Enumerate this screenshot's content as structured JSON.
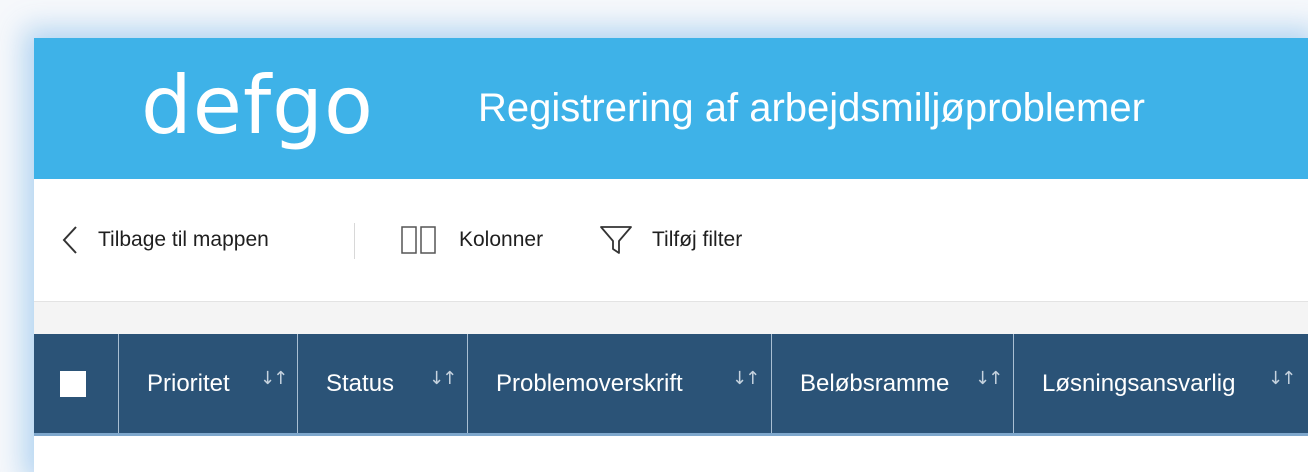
{
  "header": {
    "logo": "defgo",
    "title": "Registrering af arbejdsmiljøproblemer",
    "background": "#3eb2e8"
  },
  "toolbar": {
    "back_label": "Tilbage til mappen",
    "back_icon": "chevron-left-icon",
    "columns_label": "Kolonner",
    "columns_icon": "columns-icon",
    "filter_label": "Tilføj filter",
    "filter_icon": "filter-icon"
  },
  "grid": {
    "header_background": "#2b5377",
    "sort_symbol": "↓↑",
    "columns": [
      {
        "label": "Prioritet"
      },
      {
        "label": "Status"
      },
      {
        "label": "Problemoverskrift"
      },
      {
        "label": "Beløbsramme"
      },
      {
        "label": "Løsningsansvarlig"
      }
    ]
  }
}
